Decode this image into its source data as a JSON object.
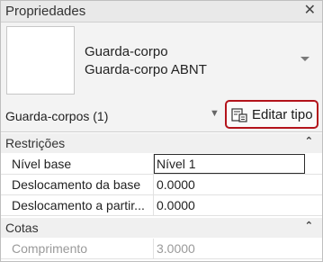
{
  "panel": {
    "title": "Propriedades",
    "close_glyph": "✕"
  },
  "type_selector": {
    "family": "Guarda-corpo",
    "type": "Guarda-corpo ABNT",
    "dropdown_icon": "triangle-down"
  },
  "filter": {
    "label": "Guarda-corpos (1)",
    "dropdown_glyph": "▼"
  },
  "edit_type_button": {
    "label": "Editar tipo",
    "highlight_color": "#b3131b"
  },
  "sections": [
    {
      "label": "Restrições",
      "collapse_glyph": "⌃",
      "rows": [
        {
          "name": "Nível base",
          "value": "Nível 1"
        },
        {
          "name": "Deslocamento da base",
          "value": "0.0000"
        },
        {
          "name": "Deslocamento a partir...",
          "value": "0.0000"
        }
      ]
    },
    {
      "label": "Cotas",
      "collapse_glyph": "⌃",
      "rows": [
        {
          "name": "Comprimento",
          "value": "3.0000"
        }
      ]
    }
  ]
}
